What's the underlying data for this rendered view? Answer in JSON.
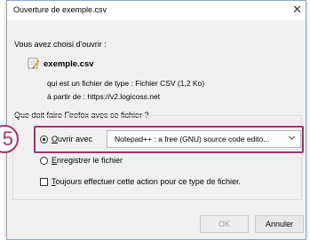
{
  "dialog": {
    "title": "Ouverture de exemple.csv",
    "intro": "Vous avez choisi d'ouvrir :",
    "file_name": "exemple.csv",
    "file_type_line": "qui est un fichier de type :  Fichier CSV (1,2 Ko)",
    "source_line": "à partir de :  https://v2.logicoss.net",
    "question": "Que doit faire Firefox avec ce fichier ?",
    "open_with": {
      "label_first": "O",
      "label_rest": "uvrir avec",
      "selected": true,
      "app_value": "Notepad++ : a free (GNU) source code edito..."
    },
    "save_file": {
      "label_first": "E",
      "label_rest": "nregistrer le fichier",
      "selected": false
    },
    "always_do": {
      "label_first": "T",
      "label_rest": "oujours effectuer cette action pour ce type de fichier.",
      "checked": false
    },
    "buttons": {
      "ok": "OK",
      "cancel": "Annuler"
    }
  },
  "annotation": {
    "step_number": "5",
    "color": "#a4346c"
  },
  "icons": {
    "close": "close-icon",
    "file": "csv-file-icon",
    "dropdown": "chevron-down-icon"
  }
}
